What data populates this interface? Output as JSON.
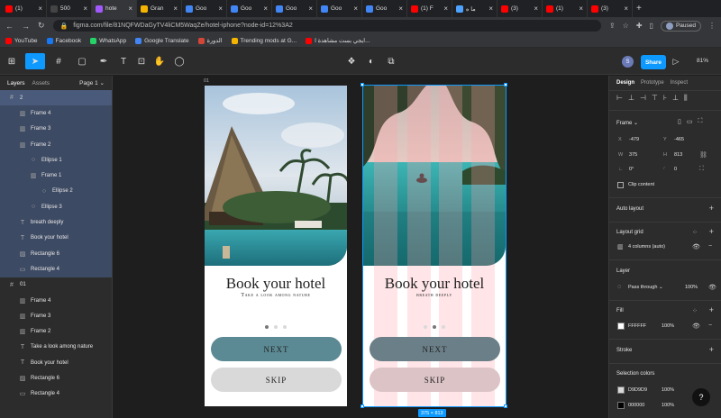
{
  "browser": {
    "tabs": [
      {
        "label": "(1)",
        "color": "#ff0000"
      },
      {
        "label": "500",
        "color": "#444444"
      },
      {
        "label": "hote",
        "color": "#a259ff",
        "active": true
      },
      {
        "label": "Gran",
        "color": "#f4b400"
      },
      {
        "label": "Goo",
        "color": "#4285f4"
      },
      {
        "label": "Goo",
        "color": "#4285f4"
      },
      {
        "label": "Goo",
        "color": "#4285f4"
      },
      {
        "label": "Goo",
        "color": "#4285f4"
      },
      {
        "label": "Goo",
        "color": "#4285f4"
      },
      {
        "label": "(1) F",
        "color": "#ff0000"
      },
      {
        "label": "ما ه",
        "color": "#4da3ff"
      },
      {
        "label": "(3)",
        "color": "#ff0000"
      },
      {
        "label": "(1)",
        "color": "#ff0000"
      },
      {
        "label": "(3)",
        "color": "#ff0000"
      }
    ],
    "url": "figma.com/file/81NQFWDaGyTV4liCM5WaqZe/hotel-iphone?node-id=12%3A2",
    "profile_status": "Paused",
    "bookmarks": [
      {
        "label": "YouTube",
        "color": "#ff0000"
      },
      {
        "label": "Facebook",
        "color": "#1877f2"
      },
      {
        "label": "WhatsApp",
        "color": "#25d366"
      },
      {
        "label": "Google Translate",
        "color": "#4285f4"
      },
      {
        "label": "الدورة",
        "color": "#d44638"
      },
      {
        "label": "Trending mods at G...",
        "color": "#f4b400"
      },
      {
        "label": "ايجي بست مشاهدة ا...",
        "color": "#ff0000"
      }
    ]
  },
  "figma": {
    "share_label": "Share",
    "avatar_initial": "S",
    "zoom": "81%",
    "left_panel": {
      "tab_layers": "Layers",
      "tab_assets": "Assets",
      "page": "Page 1",
      "layers": [
        {
          "label": "2",
          "indent": 0,
          "icon": "#",
          "state": "sel"
        },
        {
          "label": "Frame 4",
          "indent": 1,
          "icon": "▥",
          "state": "selc"
        },
        {
          "label": "Frame 3",
          "indent": 1,
          "icon": "▥",
          "state": "selc"
        },
        {
          "label": "Frame 2",
          "indent": 1,
          "icon": "▥",
          "state": "selc"
        },
        {
          "label": "Ellipse 1",
          "indent": 2,
          "icon": "○",
          "state": "selc"
        },
        {
          "label": "Frame 1",
          "indent": 2,
          "icon": "▥",
          "state": "selc"
        },
        {
          "label": "Ellipse 2",
          "indent": 3,
          "icon": "○",
          "state": "selc"
        },
        {
          "label": "Ellipse 3",
          "indent": 2,
          "icon": "○",
          "state": "selc"
        },
        {
          "label": "breath deeply",
          "indent": 1,
          "icon": "T",
          "state": "selc"
        },
        {
          "label": "Book your hotel",
          "indent": 1,
          "icon": "T",
          "state": "selc"
        },
        {
          "label": "Rectangle 6",
          "indent": 1,
          "icon": "▨",
          "state": "selc"
        },
        {
          "label": "Rectangle 4",
          "indent": 1,
          "icon": "▭",
          "state": "selc"
        },
        {
          "label": "01",
          "indent": 0,
          "icon": "#",
          "state": ""
        },
        {
          "label": "Frame 4",
          "indent": 1,
          "icon": "▥",
          "state": ""
        },
        {
          "label": "Frame 3",
          "indent": 1,
          "icon": "▥",
          "state": ""
        },
        {
          "label": "Frame 2",
          "indent": 1,
          "icon": "▥",
          "state": ""
        },
        {
          "label": "Take a look among nature",
          "indent": 1,
          "icon": "T",
          "state": ""
        },
        {
          "label": "Book your hotel",
          "indent": 1,
          "icon": "T",
          "state": ""
        },
        {
          "label": "Rectangle 6",
          "indent": 1,
          "icon": "▨",
          "state": ""
        },
        {
          "label": "Rectangle 4",
          "indent": 1,
          "icon": "▭",
          "state": ""
        }
      ]
    },
    "canvas": {
      "frame1_label": "01",
      "frame1": {
        "title": "Book your hotel",
        "subtitle": "Take a look among nature",
        "next": "NEXT",
        "skip": "SKIP"
      },
      "frame2": {
        "title": "Book your hotel",
        "subtitle": "breath deeply",
        "next": "NEXT",
        "skip": "SKIP"
      },
      "size_badge": "375 × 813",
      "colors": {
        "next_btn": "#5b8a94",
        "skip_btn": "#d9d9d9"
      }
    },
    "right_panel": {
      "tabs": [
        "Design",
        "Prototype",
        "Inspect"
      ],
      "frame_label": "Frame",
      "x_label": "X",
      "x": "-479",
      "y_label": "Y",
      "y": "-465",
      "w_label": "W",
      "w": "375",
      "h_label": "H",
      "h": "813",
      "rotation": "0°",
      "radius": "0",
      "clip_content": "Clip content",
      "auto_layout": "Auto layout",
      "layout_grid": "Layout grid",
      "grid_value": "4 columns (auto)",
      "layer": "Layer",
      "blend": "Pass through",
      "layer_opacity": "100%",
      "fill": "Fill",
      "fill_hex": "FFFFFF",
      "fill_opacity": "100%",
      "stroke": "Stroke",
      "selection_colors": "Selection colors",
      "sel_colors": [
        {
          "hex": "D9D9D9",
          "opacity": "100%",
          "color": "#d9d9d9"
        },
        {
          "hex": "000000",
          "opacity": "100%",
          "color": "#000000"
        }
      ]
    }
  }
}
